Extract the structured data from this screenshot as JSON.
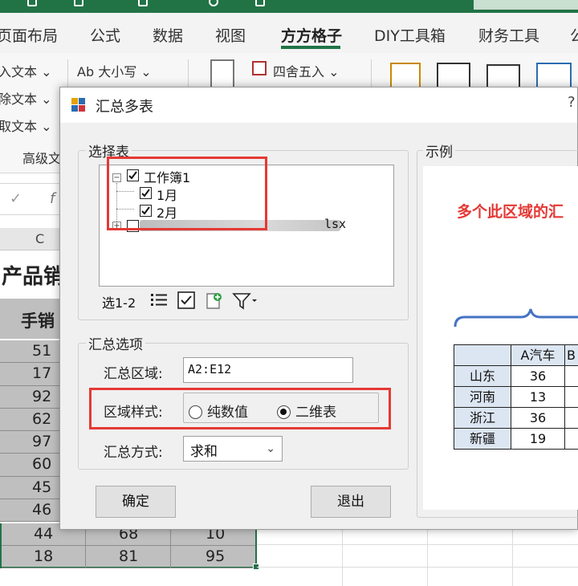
{
  "excel": {
    "tabs": [
      "页面布局",
      "公式",
      "数据",
      "视图",
      "方方格子",
      "DIY工具箱",
      "财务工具",
      "公"
    ],
    "active_tab": "方方格子",
    "ribbon": {
      "left_items": [
        "入文本 ⌄",
        "除文本 ⌄",
        "取文本 ⌄"
      ],
      "case_btn": "Ab 大小写 ⌄",
      "round_btn": "四舍五入 ⌄",
      "group_label": "高级文"
    },
    "formula_bar": {
      "fn_label": "f"
    },
    "column_header": "C",
    "title_fragment": "产品销",
    "header_fragment": "手销",
    "col_values": [
      "51",
      "17",
      "92",
      "62",
      "97",
      "60",
      "45",
      "46"
    ],
    "bottom_rows": [
      [
        "44",
        "68",
        "10"
      ],
      [
        "18",
        "81",
        "95"
      ]
    ]
  },
  "dialog": {
    "title": "汇总多表",
    "help": "?",
    "select_sheets": {
      "label": "选择表",
      "tree": {
        "workbook": "工作簿1",
        "sheets": [
          "1月",
          "2月"
        ],
        "second_file_ext": "lsx"
      },
      "toolbar": {
        "range_label": "选1-2"
      }
    },
    "options": {
      "label": "汇总选项",
      "range_label": "汇总区域:",
      "range_value": "A2:E12",
      "style_label": "区域样式:",
      "style_options": [
        "纯数值",
        "二维表"
      ],
      "style_selected": "二维表",
      "method_label": "汇总方式:",
      "method_value": "求和"
    },
    "buttons": {
      "ok": "确定",
      "exit": "退出"
    },
    "example": {
      "label": "示例",
      "caption": "多个此区域的汇",
      "headers": [
        "",
        "A汽车",
        "B"
      ],
      "rows": [
        [
          "山东",
          "36",
          ""
        ],
        [
          "河南",
          "13",
          ""
        ],
        [
          "浙江",
          "36",
          ""
        ],
        [
          "新疆",
          "19",
          ""
        ]
      ]
    }
  },
  "colors": {
    "excel_green": "#217346",
    "highlight_red": "#e53935",
    "example_blue": "#4472c4",
    "header_fill": "#dce6f2"
  }
}
